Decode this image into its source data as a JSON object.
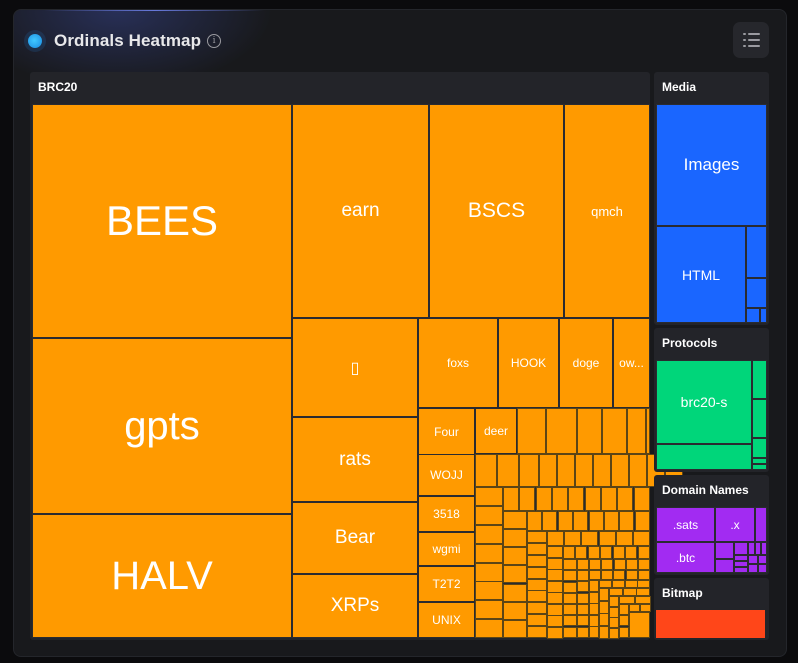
{
  "header": {
    "title": "Ordinals Heatmap",
    "info_icon": "info-icon",
    "menu_icon": "list-menu-icon"
  },
  "colors": {
    "brc20": "#ff9a00",
    "media": "#1a66ff",
    "protocols": "#00d67a",
    "domain_names": "#a22bf2",
    "bitmap": "#ff4619"
  },
  "groups": [
    {
      "name": "BRC20",
      "tiles": [
        {
          "label": "BEES"
        },
        {
          "label": "gpts"
        },
        {
          "label": "HALV"
        },
        {
          "label": "earn"
        },
        {
          "label": "BSCS"
        },
        {
          "label": "qmch"
        },
        {
          "label": "▯"
        },
        {
          "label": "foxs"
        },
        {
          "label": "HOOK"
        },
        {
          "label": "doge"
        },
        {
          "label": "ow..."
        },
        {
          "label": "rats"
        },
        {
          "label": "Bear"
        },
        {
          "label": "XRPs"
        },
        {
          "label": "Four"
        },
        {
          "label": "deer"
        },
        {
          "label": "WOJJ"
        },
        {
          "label": "3518"
        },
        {
          "label": "wgmi"
        },
        {
          "label": "T2T2"
        },
        {
          "label": "UNIX"
        }
      ]
    },
    {
      "name": "Media",
      "tiles": [
        {
          "label": "Images"
        },
        {
          "label": "HTML"
        }
      ]
    },
    {
      "name": "Protocols",
      "tiles": [
        {
          "label": "brc20-s"
        }
      ]
    },
    {
      "name": "Domain Names",
      "tiles": [
        {
          "label": ".sats"
        },
        {
          "label": ".x"
        },
        {
          "label": ".btc"
        }
      ]
    },
    {
      "name": "Bitmap",
      "tiles": []
    }
  ]
}
